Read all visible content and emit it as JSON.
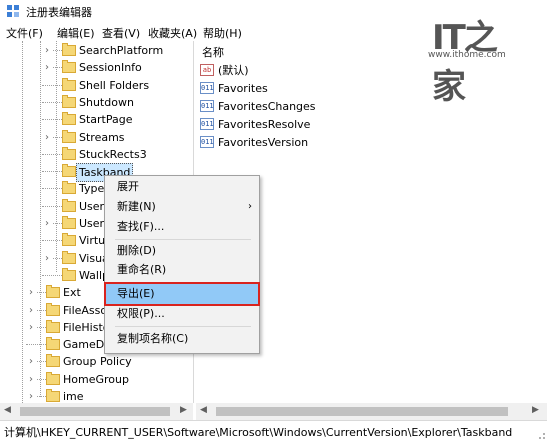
{
  "window": {
    "title": "注册表编辑器"
  },
  "menu": [
    "文件(F)",
    "编辑(E)",
    "查看(V)",
    "收藏夹(A)",
    "帮助(H)"
  ],
  "watermark": {
    "logo_text": "IT之家",
    "url": "www.ithome.com"
  },
  "tree": {
    "items": [
      {
        "label": "SearchPlatform",
        "expandable": true
      },
      {
        "label": "SessionInfo",
        "expandable": true
      },
      {
        "label": "Shell Folders",
        "expandable": false
      },
      {
        "label": "Shutdown",
        "expandable": false
      },
      {
        "label": "StartPage",
        "expandable": false
      },
      {
        "label": "Streams",
        "expandable": true
      },
      {
        "label": "StuckRects3",
        "expandable": false
      },
      {
        "label": "Taskband",
        "expandable": false,
        "selected": true
      },
      {
        "label": "TypedP",
        "expandable": false
      },
      {
        "label": "User Sh",
        "expandable": false
      },
      {
        "label": "UserAs",
        "expandable": true
      },
      {
        "label": "VirtualD",
        "expandable": false
      },
      {
        "label": "VisualE",
        "expandable": true
      },
      {
        "label": "Wallpa",
        "expandable": false
      },
      {
        "label": "Ext",
        "expandable": true
      },
      {
        "label": "FileAssocia",
        "expandable": true
      },
      {
        "label": "FileHistory",
        "expandable": true
      },
      {
        "label": "GameDVR",
        "expandable": false
      },
      {
        "label": "Group Policy",
        "expandable": true
      },
      {
        "label": "HomeGroup",
        "expandable": true
      },
      {
        "label": "ime",
        "expandable": true
      }
    ]
  },
  "values_pane": {
    "column_header": "名称",
    "rows": [
      {
        "name": "(默认)",
        "type": "sz"
      },
      {
        "name": "Favorites",
        "type": "bin"
      },
      {
        "name": "FavoritesChanges",
        "type": "bin"
      },
      {
        "name": "FavoritesResolve",
        "type": "bin"
      },
      {
        "name": "FavoritesVersion",
        "type": "bin"
      }
    ]
  },
  "context_menu": {
    "items": [
      {
        "label": "展开"
      },
      {
        "label": "新建(N)",
        "submenu_arrow": "›"
      },
      {
        "label": "查找(F)..."
      },
      {
        "label": "删除(D)"
      },
      {
        "label": "重命名(R)"
      },
      {
        "label": "导出(E)",
        "highlighted": true
      },
      {
        "label": "权限(P)..."
      },
      {
        "label": "复制项名称(C)"
      }
    ]
  },
  "statusbar": {
    "path": "计算机\\HKEY_CURRENT_USER\\Software\\Microsoft\\Windows\\CurrentVersion\\Explorer\\Taskband"
  }
}
